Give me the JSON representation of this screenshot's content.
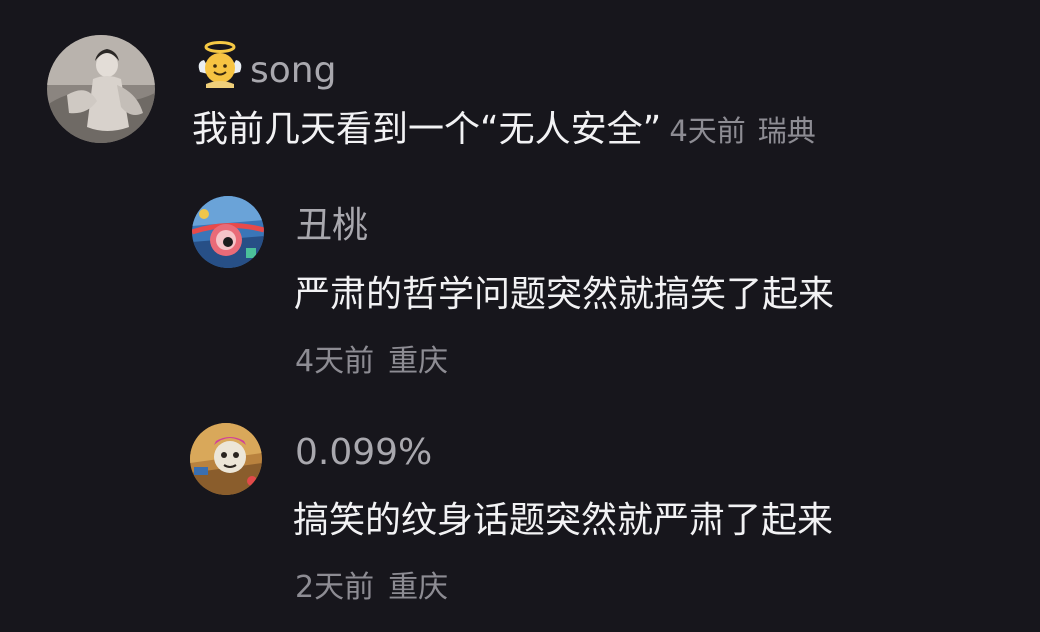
{
  "comments": [
    {
      "username": "song",
      "badge_icon": "angel-emoji-icon",
      "text": "我前几天看到一个“无人安全”",
      "time": "4天前",
      "location": "瑞典",
      "replies": [
        {
          "username": "丑桃",
          "text": "严肃的哲学问题突然就搞笑了起来",
          "time": "4天前",
          "location": "重庆"
        },
        {
          "username": "0.099%",
          "text": "搞笑的纹身话题突然就严肃了起来",
          "time": "2天前",
          "location": "重庆"
        }
      ]
    }
  ]
}
